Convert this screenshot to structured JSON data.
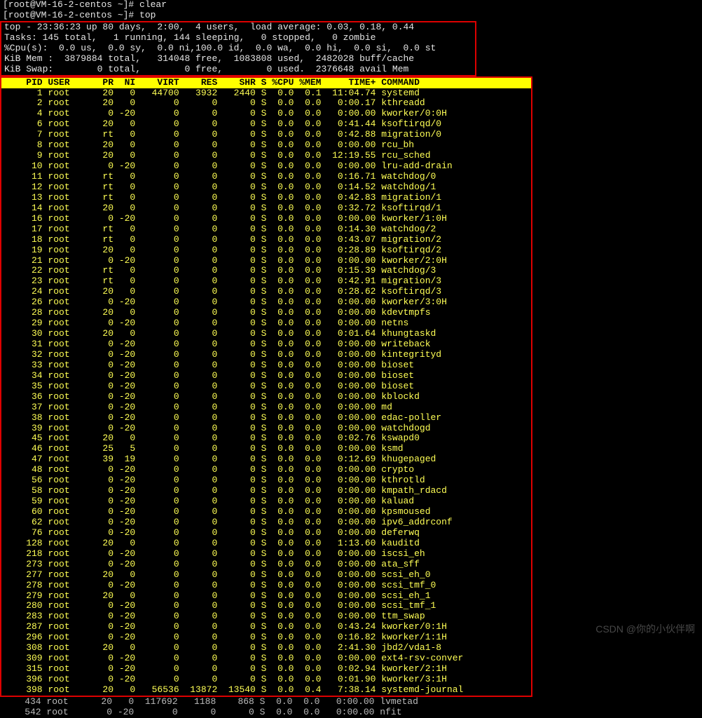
{
  "prompt": {
    "line1": "[root@VM-16-2-centos ~]# clear",
    "line2": "[root@VM-16-2-centos ~]# top"
  },
  "summary": {
    "line1": "top - 23:36:23 up 80 days,  2:00,  4 users,  load average: 0.03, 0.18, 0.44",
    "line2": "Tasks: 145 total,   1 running, 144 sleeping,   0 stopped,   0 zombie",
    "line3": "%Cpu(s):  0.0 us,  0.0 sy,  0.0 ni,100.0 id,  0.0 wa,  0.0 hi,  0.0 si,  0.0 st",
    "line4": "KiB Mem :  3879884 total,   314048 free,  1083808 used,  2482028 buff/cache",
    "line5": "KiB Swap:        0 total,        0 free,        0 used.  2376648 avail Mem"
  },
  "columns": [
    "PID",
    "USER",
    "PR",
    "NI",
    "VIRT",
    "RES",
    "SHR",
    "S",
    "%CPU",
    "%MEM",
    "TIME+",
    "COMMAND"
  ],
  "processes": [
    {
      "pid": 1,
      "user": "root",
      "pr": "20",
      "ni": "0",
      "virt": "44700",
      "res": "3932",
      "shr": "2440",
      "s": "S",
      "cpu": "0.0",
      "mem": "0.1",
      "time": "11:04.74",
      "cmd": "systemd"
    },
    {
      "pid": 2,
      "user": "root",
      "pr": "20",
      "ni": "0",
      "virt": "0",
      "res": "0",
      "shr": "0",
      "s": "S",
      "cpu": "0.0",
      "mem": "0.0",
      "time": "0:00.17",
      "cmd": "kthreadd"
    },
    {
      "pid": 4,
      "user": "root",
      "pr": "0",
      "ni": "-20",
      "virt": "0",
      "res": "0",
      "shr": "0",
      "s": "S",
      "cpu": "0.0",
      "mem": "0.0",
      "time": "0:00.00",
      "cmd": "kworker/0:0H"
    },
    {
      "pid": 6,
      "user": "root",
      "pr": "20",
      "ni": "0",
      "virt": "0",
      "res": "0",
      "shr": "0",
      "s": "S",
      "cpu": "0.0",
      "mem": "0.0",
      "time": "0:41.44",
      "cmd": "ksoftirqd/0"
    },
    {
      "pid": 7,
      "user": "root",
      "pr": "rt",
      "ni": "0",
      "virt": "0",
      "res": "0",
      "shr": "0",
      "s": "S",
      "cpu": "0.0",
      "mem": "0.0",
      "time": "0:42.88",
      "cmd": "migration/0"
    },
    {
      "pid": 8,
      "user": "root",
      "pr": "20",
      "ni": "0",
      "virt": "0",
      "res": "0",
      "shr": "0",
      "s": "S",
      "cpu": "0.0",
      "mem": "0.0",
      "time": "0:00.00",
      "cmd": "rcu_bh"
    },
    {
      "pid": 9,
      "user": "root",
      "pr": "20",
      "ni": "0",
      "virt": "0",
      "res": "0",
      "shr": "0",
      "s": "S",
      "cpu": "0.0",
      "mem": "0.0",
      "time": "12:19.55",
      "cmd": "rcu_sched"
    },
    {
      "pid": 10,
      "user": "root",
      "pr": "0",
      "ni": "-20",
      "virt": "0",
      "res": "0",
      "shr": "0",
      "s": "S",
      "cpu": "0.0",
      "mem": "0.0",
      "time": "0:00.00",
      "cmd": "lru-add-drain"
    },
    {
      "pid": 11,
      "user": "root",
      "pr": "rt",
      "ni": "0",
      "virt": "0",
      "res": "0",
      "shr": "0",
      "s": "S",
      "cpu": "0.0",
      "mem": "0.0",
      "time": "0:16.71",
      "cmd": "watchdog/0"
    },
    {
      "pid": 12,
      "user": "root",
      "pr": "rt",
      "ni": "0",
      "virt": "0",
      "res": "0",
      "shr": "0",
      "s": "S",
      "cpu": "0.0",
      "mem": "0.0",
      "time": "0:14.52",
      "cmd": "watchdog/1"
    },
    {
      "pid": 13,
      "user": "root",
      "pr": "rt",
      "ni": "0",
      "virt": "0",
      "res": "0",
      "shr": "0",
      "s": "S",
      "cpu": "0.0",
      "mem": "0.0",
      "time": "0:42.83",
      "cmd": "migration/1"
    },
    {
      "pid": 14,
      "user": "root",
      "pr": "20",
      "ni": "0",
      "virt": "0",
      "res": "0",
      "shr": "0",
      "s": "S",
      "cpu": "0.0",
      "mem": "0.0",
      "time": "0:32.72",
      "cmd": "ksoftirqd/1"
    },
    {
      "pid": 16,
      "user": "root",
      "pr": "0",
      "ni": "-20",
      "virt": "0",
      "res": "0",
      "shr": "0",
      "s": "S",
      "cpu": "0.0",
      "mem": "0.0",
      "time": "0:00.00",
      "cmd": "kworker/1:0H"
    },
    {
      "pid": 17,
      "user": "root",
      "pr": "rt",
      "ni": "0",
      "virt": "0",
      "res": "0",
      "shr": "0",
      "s": "S",
      "cpu": "0.0",
      "mem": "0.0",
      "time": "0:14.30",
      "cmd": "watchdog/2"
    },
    {
      "pid": 18,
      "user": "root",
      "pr": "rt",
      "ni": "0",
      "virt": "0",
      "res": "0",
      "shr": "0",
      "s": "S",
      "cpu": "0.0",
      "mem": "0.0",
      "time": "0:43.07",
      "cmd": "migration/2"
    },
    {
      "pid": 19,
      "user": "root",
      "pr": "20",
      "ni": "0",
      "virt": "0",
      "res": "0",
      "shr": "0",
      "s": "S",
      "cpu": "0.0",
      "mem": "0.0",
      "time": "0:28.89",
      "cmd": "ksoftirqd/2"
    },
    {
      "pid": 21,
      "user": "root",
      "pr": "0",
      "ni": "-20",
      "virt": "0",
      "res": "0",
      "shr": "0",
      "s": "S",
      "cpu": "0.0",
      "mem": "0.0",
      "time": "0:00.00",
      "cmd": "kworker/2:0H"
    },
    {
      "pid": 22,
      "user": "root",
      "pr": "rt",
      "ni": "0",
      "virt": "0",
      "res": "0",
      "shr": "0",
      "s": "S",
      "cpu": "0.0",
      "mem": "0.0",
      "time": "0:15.39",
      "cmd": "watchdog/3"
    },
    {
      "pid": 23,
      "user": "root",
      "pr": "rt",
      "ni": "0",
      "virt": "0",
      "res": "0",
      "shr": "0",
      "s": "S",
      "cpu": "0.0",
      "mem": "0.0",
      "time": "0:42.91",
      "cmd": "migration/3"
    },
    {
      "pid": 24,
      "user": "root",
      "pr": "20",
      "ni": "0",
      "virt": "0",
      "res": "0",
      "shr": "0",
      "s": "S",
      "cpu": "0.0",
      "mem": "0.0",
      "time": "0:28.62",
      "cmd": "ksoftirqd/3"
    },
    {
      "pid": 26,
      "user": "root",
      "pr": "0",
      "ni": "-20",
      "virt": "0",
      "res": "0",
      "shr": "0",
      "s": "S",
      "cpu": "0.0",
      "mem": "0.0",
      "time": "0:00.00",
      "cmd": "kworker/3:0H"
    },
    {
      "pid": 28,
      "user": "root",
      "pr": "20",
      "ni": "0",
      "virt": "0",
      "res": "0",
      "shr": "0",
      "s": "S",
      "cpu": "0.0",
      "mem": "0.0",
      "time": "0:00.00",
      "cmd": "kdevtmpfs"
    },
    {
      "pid": 29,
      "user": "root",
      "pr": "0",
      "ni": "-20",
      "virt": "0",
      "res": "0",
      "shr": "0",
      "s": "S",
      "cpu": "0.0",
      "mem": "0.0",
      "time": "0:00.00",
      "cmd": "netns"
    },
    {
      "pid": 30,
      "user": "root",
      "pr": "20",
      "ni": "0",
      "virt": "0",
      "res": "0",
      "shr": "0",
      "s": "S",
      "cpu": "0.0",
      "mem": "0.0",
      "time": "0:01.64",
      "cmd": "khungtaskd"
    },
    {
      "pid": 31,
      "user": "root",
      "pr": "0",
      "ni": "-20",
      "virt": "0",
      "res": "0",
      "shr": "0",
      "s": "S",
      "cpu": "0.0",
      "mem": "0.0",
      "time": "0:00.00",
      "cmd": "writeback"
    },
    {
      "pid": 32,
      "user": "root",
      "pr": "0",
      "ni": "-20",
      "virt": "0",
      "res": "0",
      "shr": "0",
      "s": "S",
      "cpu": "0.0",
      "mem": "0.0",
      "time": "0:00.00",
      "cmd": "kintegrityd"
    },
    {
      "pid": 33,
      "user": "root",
      "pr": "0",
      "ni": "-20",
      "virt": "0",
      "res": "0",
      "shr": "0",
      "s": "S",
      "cpu": "0.0",
      "mem": "0.0",
      "time": "0:00.00",
      "cmd": "bioset"
    },
    {
      "pid": 34,
      "user": "root",
      "pr": "0",
      "ni": "-20",
      "virt": "0",
      "res": "0",
      "shr": "0",
      "s": "S",
      "cpu": "0.0",
      "mem": "0.0",
      "time": "0:00.00",
      "cmd": "bioset"
    },
    {
      "pid": 35,
      "user": "root",
      "pr": "0",
      "ni": "-20",
      "virt": "0",
      "res": "0",
      "shr": "0",
      "s": "S",
      "cpu": "0.0",
      "mem": "0.0",
      "time": "0:00.00",
      "cmd": "bioset"
    },
    {
      "pid": 36,
      "user": "root",
      "pr": "0",
      "ni": "-20",
      "virt": "0",
      "res": "0",
      "shr": "0",
      "s": "S",
      "cpu": "0.0",
      "mem": "0.0",
      "time": "0:00.00",
      "cmd": "kblockd"
    },
    {
      "pid": 37,
      "user": "root",
      "pr": "0",
      "ni": "-20",
      "virt": "0",
      "res": "0",
      "shr": "0",
      "s": "S",
      "cpu": "0.0",
      "mem": "0.0",
      "time": "0:00.00",
      "cmd": "md"
    },
    {
      "pid": 38,
      "user": "root",
      "pr": "0",
      "ni": "-20",
      "virt": "0",
      "res": "0",
      "shr": "0",
      "s": "S",
      "cpu": "0.0",
      "mem": "0.0",
      "time": "0:00.00",
      "cmd": "edac-poller"
    },
    {
      "pid": 39,
      "user": "root",
      "pr": "0",
      "ni": "-20",
      "virt": "0",
      "res": "0",
      "shr": "0",
      "s": "S",
      "cpu": "0.0",
      "mem": "0.0",
      "time": "0:00.00",
      "cmd": "watchdogd"
    },
    {
      "pid": 45,
      "user": "root",
      "pr": "20",
      "ni": "0",
      "virt": "0",
      "res": "0",
      "shr": "0",
      "s": "S",
      "cpu": "0.0",
      "mem": "0.0",
      "time": "0:02.76",
      "cmd": "kswapd0"
    },
    {
      "pid": 46,
      "user": "root",
      "pr": "25",
      "ni": "5",
      "virt": "0",
      "res": "0",
      "shr": "0",
      "s": "S",
      "cpu": "0.0",
      "mem": "0.0",
      "time": "0:00.00",
      "cmd": "ksmd"
    },
    {
      "pid": 47,
      "user": "root",
      "pr": "39",
      "ni": "19",
      "virt": "0",
      "res": "0",
      "shr": "0",
      "s": "S",
      "cpu": "0.0",
      "mem": "0.0",
      "time": "0:12.69",
      "cmd": "khugepaged"
    },
    {
      "pid": 48,
      "user": "root",
      "pr": "0",
      "ni": "-20",
      "virt": "0",
      "res": "0",
      "shr": "0",
      "s": "S",
      "cpu": "0.0",
      "mem": "0.0",
      "time": "0:00.00",
      "cmd": "crypto"
    },
    {
      "pid": 56,
      "user": "root",
      "pr": "0",
      "ni": "-20",
      "virt": "0",
      "res": "0",
      "shr": "0",
      "s": "S",
      "cpu": "0.0",
      "mem": "0.0",
      "time": "0:00.00",
      "cmd": "kthrotld"
    },
    {
      "pid": 58,
      "user": "root",
      "pr": "0",
      "ni": "-20",
      "virt": "0",
      "res": "0",
      "shr": "0",
      "s": "S",
      "cpu": "0.0",
      "mem": "0.0",
      "time": "0:00.00",
      "cmd": "kmpath_rdacd"
    },
    {
      "pid": 59,
      "user": "root",
      "pr": "0",
      "ni": "-20",
      "virt": "0",
      "res": "0",
      "shr": "0",
      "s": "S",
      "cpu": "0.0",
      "mem": "0.0",
      "time": "0:00.00",
      "cmd": "kaluad"
    },
    {
      "pid": 60,
      "user": "root",
      "pr": "0",
      "ni": "-20",
      "virt": "0",
      "res": "0",
      "shr": "0",
      "s": "S",
      "cpu": "0.0",
      "mem": "0.0",
      "time": "0:00.00",
      "cmd": "kpsmoused"
    },
    {
      "pid": 62,
      "user": "root",
      "pr": "0",
      "ni": "-20",
      "virt": "0",
      "res": "0",
      "shr": "0",
      "s": "S",
      "cpu": "0.0",
      "mem": "0.0",
      "time": "0:00.00",
      "cmd": "ipv6_addrconf"
    },
    {
      "pid": 76,
      "user": "root",
      "pr": "0",
      "ni": "-20",
      "virt": "0",
      "res": "0",
      "shr": "0",
      "s": "S",
      "cpu": "0.0",
      "mem": "0.0",
      "time": "0:00.00",
      "cmd": "deferwq"
    },
    {
      "pid": 128,
      "user": "root",
      "pr": "20",
      "ni": "0",
      "virt": "0",
      "res": "0",
      "shr": "0",
      "s": "S",
      "cpu": "0.0",
      "mem": "0.0",
      "time": "1:13.60",
      "cmd": "kauditd"
    },
    {
      "pid": 218,
      "user": "root",
      "pr": "0",
      "ni": "-20",
      "virt": "0",
      "res": "0",
      "shr": "0",
      "s": "S",
      "cpu": "0.0",
      "mem": "0.0",
      "time": "0:00.00",
      "cmd": "iscsi_eh"
    },
    {
      "pid": 273,
      "user": "root",
      "pr": "0",
      "ni": "-20",
      "virt": "0",
      "res": "0",
      "shr": "0",
      "s": "S",
      "cpu": "0.0",
      "mem": "0.0",
      "time": "0:00.00",
      "cmd": "ata_sff"
    },
    {
      "pid": 277,
      "user": "root",
      "pr": "20",
      "ni": "0",
      "virt": "0",
      "res": "0",
      "shr": "0",
      "s": "S",
      "cpu": "0.0",
      "mem": "0.0",
      "time": "0:00.00",
      "cmd": "scsi_eh_0"
    },
    {
      "pid": 278,
      "user": "root",
      "pr": "0",
      "ni": "-20",
      "virt": "0",
      "res": "0",
      "shr": "0",
      "s": "S",
      "cpu": "0.0",
      "mem": "0.0",
      "time": "0:00.00",
      "cmd": "scsi_tmf_0"
    },
    {
      "pid": 279,
      "user": "root",
      "pr": "20",
      "ni": "0",
      "virt": "0",
      "res": "0",
      "shr": "0",
      "s": "S",
      "cpu": "0.0",
      "mem": "0.0",
      "time": "0:00.00",
      "cmd": "scsi_eh_1"
    },
    {
      "pid": 280,
      "user": "root",
      "pr": "0",
      "ni": "-20",
      "virt": "0",
      "res": "0",
      "shr": "0",
      "s": "S",
      "cpu": "0.0",
      "mem": "0.0",
      "time": "0:00.00",
      "cmd": "scsi_tmf_1"
    },
    {
      "pid": 283,
      "user": "root",
      "pr": "0",
      "ni": "-20",
      "virt": "0",
      "res": "0",
      "shr": "0",
      "s": "S",
      "cpu": "0.0",
      "mem": "0.0",
      "time": "0:00.00",
      "cmd": "ttm_swap"
    },
    {
      "pid": 287,
      "user": "root",
      "pr": "0",
      "ni": "-20",
      "virt": "0",
      "res": "0",
      "shr": "0",
      "s": "S",
      "cpu": "0.0",
      "mem": "0.0",
      "time": "0:43.24",
      "cmd": "kworker/0:1H"
    },
    {
      "pid": 296,
      "user": "root",
      "pr": "0",
      "ni": "-20",
      "virt": "0",
      "res": "0",
      "shr": "0",
      "s": "S",
      "cpu": "0.0",
      "mem": "0.0",
      "time": "0:16.82",
      "cmd": "kworker/1:1H"
    },
    {
      "pid": 308,
      "user": "root",
      "pr": "20",
      "ni": "0",
      "virt": "0",
      "res": "0",
      "shr": "0",
      "s": "S",
      "cpu": "0.0",
      "mem": "0.0",
      "time": "2:41.30",
      "cmd": "jbd2/vda1-8"
    },
    {
      "pid": 309,
      "user": "root",
      "pr": "0",
      "ni": "-20",
      "virt": "0",
      "res": "0",
      "shr": "0",
      "s": "S",
      "cpu": "0.0",
      "mem": "0.0",
      "time": "0:00.00",
      "cmd": "ext4-rsv-conver"
    },
    {
      "pid": 315,
      "user": "root",
      "pr": "0",
      "ni": "-20",
      "virt": "0",
      "res": "0",
      "shr": "0",
      "s": "S",
      "cpu": "0.0",
      "mem": "0.0",
      "time": "0:02.94",
      "cmd": "kworker/2:1H"
    },
    {
      "pid": 396,
      "user": "root",
      "pr": "0",
      "ni": "-20",
      "virt": "0",
      "res": "0",
      "shr": "0",
      "s": "S",
      "cpu": "0.0",
      "mem": "0.0",
      "time": "0:01.90",
      "cmd": "kworker/3:1H"
    },
    {
      "pid": 398,
      "user": "root",
      "pr": "20",
      "ni": "0",
      "virt": "56536",
      "res": "13872",
      "shr": "13540",
      "s": "S",
      "cpu": "0.0",
      "mem": "0.4",
      "time": "7:38.14",
      "cmd": "systemd-journal"
    }
  ],
  "after": [
    {
      "pid": 434,
      "user": "root",
      "pr": "20",
      "ni": "0",
      "virt": "117692",
      "res": "1188",
      "shr": "868",
      "s": "S",
      "cpu": "0.0",
      "mem": "0.0",
      "time": "0:00.00",
      "cmd": "lvmetad"
    },
    {
      "pid": 542,
      "user": "root",
      "pr": "0",
      "ni": "-20",
      "virt": "0",
      "res": "0",
      "shr": "0",
      "s": "S",
      "cpu": "0.0",
      "mem": "0.0",
      "time": "0:00.00",
      "cmd": "nfit"
    }
  ],
  "watermark": "CSDN @你的小伙伴啊"
}
